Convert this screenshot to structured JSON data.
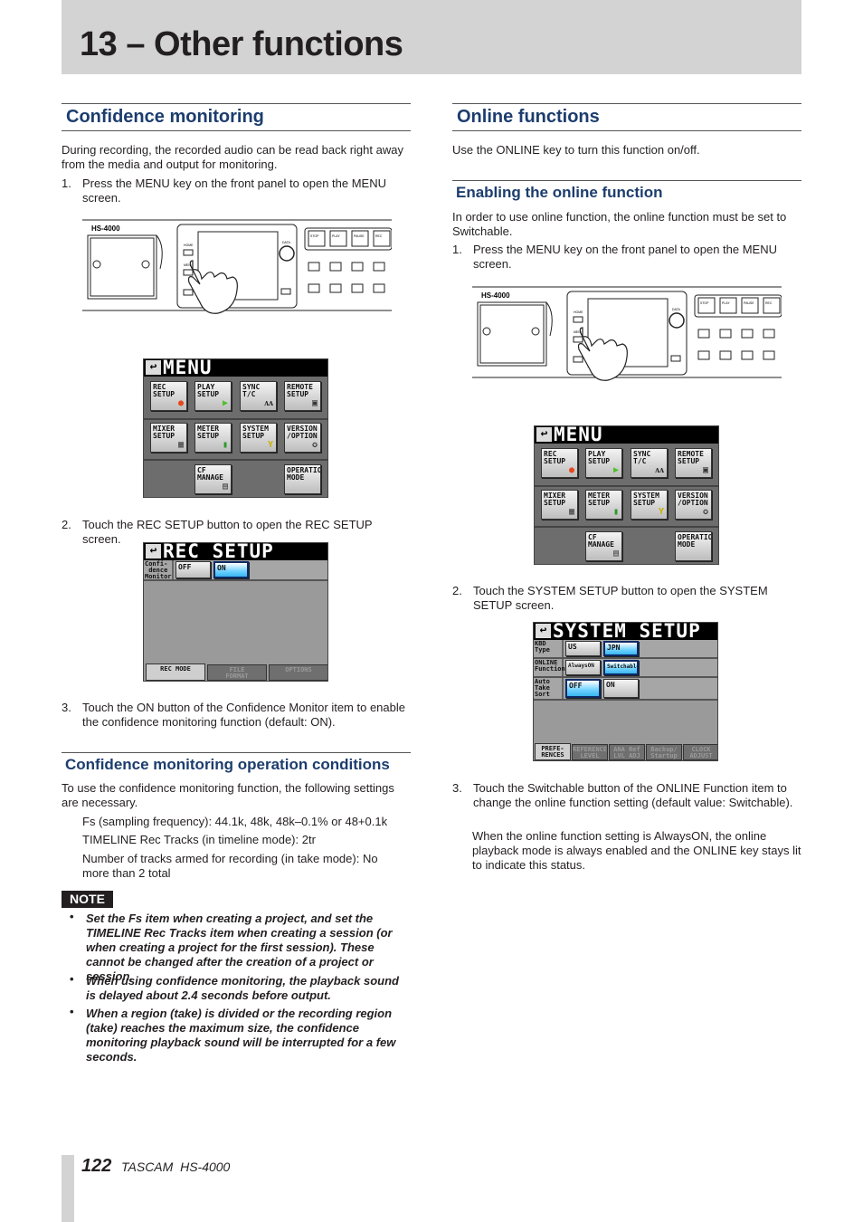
{
  "chapter_title": "13 – Other functions",
  "left": {
    "heading": "Confidence monitoring",
    "intro": "During recording, the recorded audio can be read back right away from the media and output for monitoring.",
    "steps": [
      {
        "num": "1.",
        "text": "Press the MENU key on the front panel to open the MENU screen."
      },
      {
        "num": "2.",
        "text": "Touch the REC SETUP button to open the REC SETUP screen."
      },
      {
        "num": "3.",
        "text": "Touch the ON button of the Confidence Monitor item to enable the confidence monitoring function (default: ON)."
      }
    ],
    "subheading": "Confidence monitoring operation conditions",
    "conditions_intro": "To use the confidence monitoring function, the following settings are necessary.",
    "conditions": [
      "Fs (sampling frequency): 44.1k, 48k, 48k–0.1% or 48+0.1k",
      "TIMELINE Rec Tracks (in timeline mode): 2tr",
      "Number of tracks armed for recording (in take mode): No more than 2 total"
    ],
    "note_label": "NOTE",
    "notes": [
      " Set the Fs item when creating a project, and set the TIMELINE Rec Tracks item when creating a session (or when creating a project for the first session). These cannot be changed after the creation of a project or session.",
      "When using confidence monitoring, the playback sound is delayed about 2.4 seconds before output.",
      "When a region (take) is divided or the recording region (take) reaches the maximum size, the confidence monitoring playback sound will be interrupted for a few seconds."
    ]
  },
  "right": {
    "heading": "Online functions",
    "intro": "Use the ONLINE key to turn this function on/off.",
    "subheading": "Enabling the online function",
    "sub_intro": "In order to use online function, the online function must be set to Switchable.",
    "steps": [
      {
        "num": "1.",
        "text": "Press the MENU key on the front panel to open the MENU screen."
      },
      {
        "num": "2.",
        "text": "Touch the SYSTEM SETUP button to open the SYSTEM SETUP screen."
      },
      {
        "num": "3.",
        "text": "Touch the Switchable button of the ONLINE Function item to change the online function setting (default value: Switchable)."
      }
    ],
    "step3_extra": "When the online function setting is AlwaysON, the online playback mode is always enabled and the ONLINE key stays lit to indicate this status."
  },
  "device": {
    "model": "HS-4000",
    "keys": [
      "STOP",
      "PLAY",
      "PAUSE",
      "REC",
      "HOME",
      "MENU",
      "DATA"
    ]
  },
  "menu_screen": {
    "title": "MENU",
    "back_icon": "return-arrow-icon",
    "buttons": [
      {
        "label": "REC\nSETUP",
        "icon": "●",
        "color": "#e8471c"
      },
      {
        "label": "PLAY\nSETUP",
        "icon": "▶",
        "color": "#4cc02a"
      },
      {
        "label": "SYNC\nT/C",
        "icon": "ᴧᴧ",
        "color": "#222"
      },
      {
        "label": "REMOTE\nSETUP",
        "icon": "▣",
        "color": "#333"
      },
      {
        "label": "MIXER\nSETUP",
        "icon": "▦",
        "color": "#444"
      },
      {
        "label": "METER\nSETUP",
        "icon": "▮",
        "color": "#2a9a2a"
      },
      {
        "label": "SYSTEM\nSETUP",
        "icon": "Y",
        "color": "#c8b000"
      },
      {
        "label": "VERSION\n/OPTION",
        "icon": "✪",
        "color": "#333"
      },
      {
        "label": "CF\nMANAGE",
        "icon": "▤",
        "color": "#444"
      },
      {
        "label": "OPERATION\nMODE",
        "icon": "",
        "color": "#333"
      }
    ]
  },
  "rec_setup_screen": {
    "title": "REC SETUP",
    "row_label": "Confi-\n dence\nMonitor",
    "options": [
      "OFF",
      "ON"
    ],
    "selected": "ON",
    "tabs": [
      "REC MODE",
      "FILE\nFORMAT",
      "OPTIONS"
    ],
    "active_tab": "REC MODE"
  },
  "system_setup_screen": {
    "title": "SYSTEM SETUP",
    "rows": [
      {
        "label": "KBD\nType",
        "options": [
          "US",
          "JPN"
        ],
        "selected": "JPN"
      },
      {
        "label": "ONLINE\nFunction",
        "options": [
          "AlwaysON",
          "Switchable"
        ],
        "selected": "Switchable"
      },
      {
        "label": "Auto\nTake\nSort",
        "options": [
          "OFF",
          "ON"
        ],
        "selected": "OFF"
      }
    ],
    "tabs": [
      "PREFE-\nRENCES",
      "REFERENCE\nLEVEL",
      "ANA Ref\nLVL ADJ",
      "Backup/\nStartup",
      "CLOCK\nADJUST"
    ],
    "active_tab": "PREFE-\nRENCES"
  },
  "footer": {
    "page": "122",
    "brand": "TASCAM  HS-4000"
  },
  "colors": {
    "heading": "#1c3d6e",
    "header_band": "#d3d3d3",
    "selected_button": "#6fd2ff"
  }
}
